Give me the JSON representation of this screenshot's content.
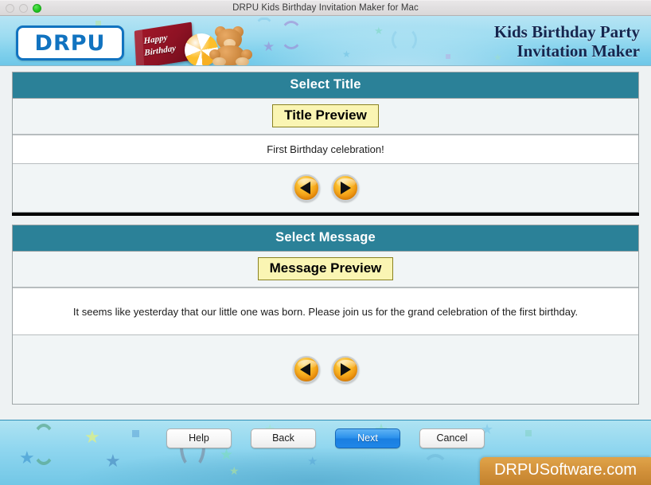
{
  "window": {
    "title": "DRPU Kids Birthday Invitation Maker for Mac",
    "controls": {
      "close": "close-button",
      "minimize": "minimize-button",
      "zoom": "zoom-button"
    }
  },
  "header": {
    "logo_text": "DRPU",
    "card_line1": "Happy",
    "card_line2": "Birthday",
    "title_line1": "Kids Birthday Party",
    "title_line2": "Invitation Maker"
  },
  "title_section": {
    "header": "Select Title",
    "preview_label": "Title Preview",
    "value": "First Birthday celebration!",
    "prev_label": "previous-title",
    "next_label": "next-title"
  },
  "message_section": {
    "header": "Select Message",
    "preview_label": "Message Preview",
    "value": "It seems like yesterday that our little one was born. Please join us for the grand celebration of the first birthday.",
    "prev_label": "previous-message",
    "next_label": "next-message"
  },
  "footer": {
    "buttons": [
      {
        "label": "Help",
        "name": "help-button",
        "primary": false
      },
      {
        "label": "Back",
        "name": "back-button",
        "primary": false
      },
      {
        "label": "Next",
        "name": "next-button",
        "primary": true
      },
      {
        "label": "Cancel",
        "name": "cancel-button",
        "primary": false
      }
    ],
    "watermark": "DRPUSoftware.com"
  },
  "colors": {
    "panel_header_teal": "#2b8198",
    "preview_chip_yellow": "#faf5b3",
    "primary_button_blue": "#1a7ee0",
    "watermark_orange": "#d2913a",
    "banner_blue": "#9ddcf1",
    "logo_blue": "#1173c0"
  }
}
